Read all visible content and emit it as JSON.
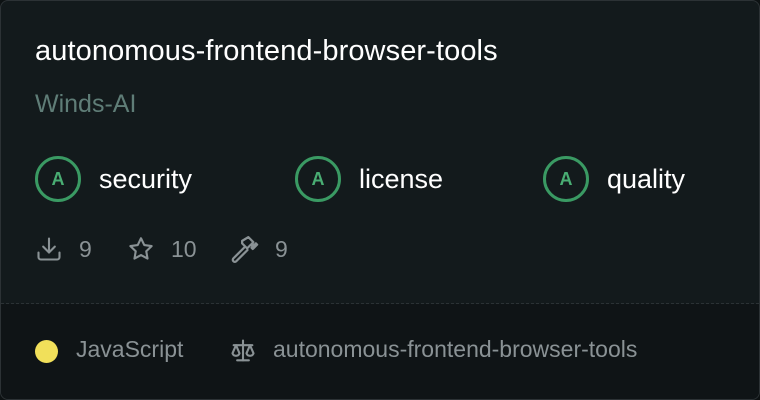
{
  "repo": {
    "name": "autonomous-frontend-browser-tools",
    "owner": "Winds-AI"
  },
  "grades": [
    {
      "letter": "A",
      "label": "security"
    },
    {
      "letter": "A",
      "label": "license"
    },
    {
      "letter": "A",
      "label": "quality"
    }
  ],
  "stats": {
    "downloads": "9",
    "stars": "10",
    "tools": "9"
  },
  "footer": {
    "language": "JavaScript",
    "language_color": "#f1e05a",
    "license_text": "autonomous-frontend-browser-tools"
  },
  "colors": {
    "grade_accent": "#3a9a63",
    "owner_text": "#5f7d77"
  },
  "icons": {
    "downloads": "download-icon",
    "stars": "star-icon",
    "tools": "hammer-icon",
    "license": "scale-icon"
  }
}
